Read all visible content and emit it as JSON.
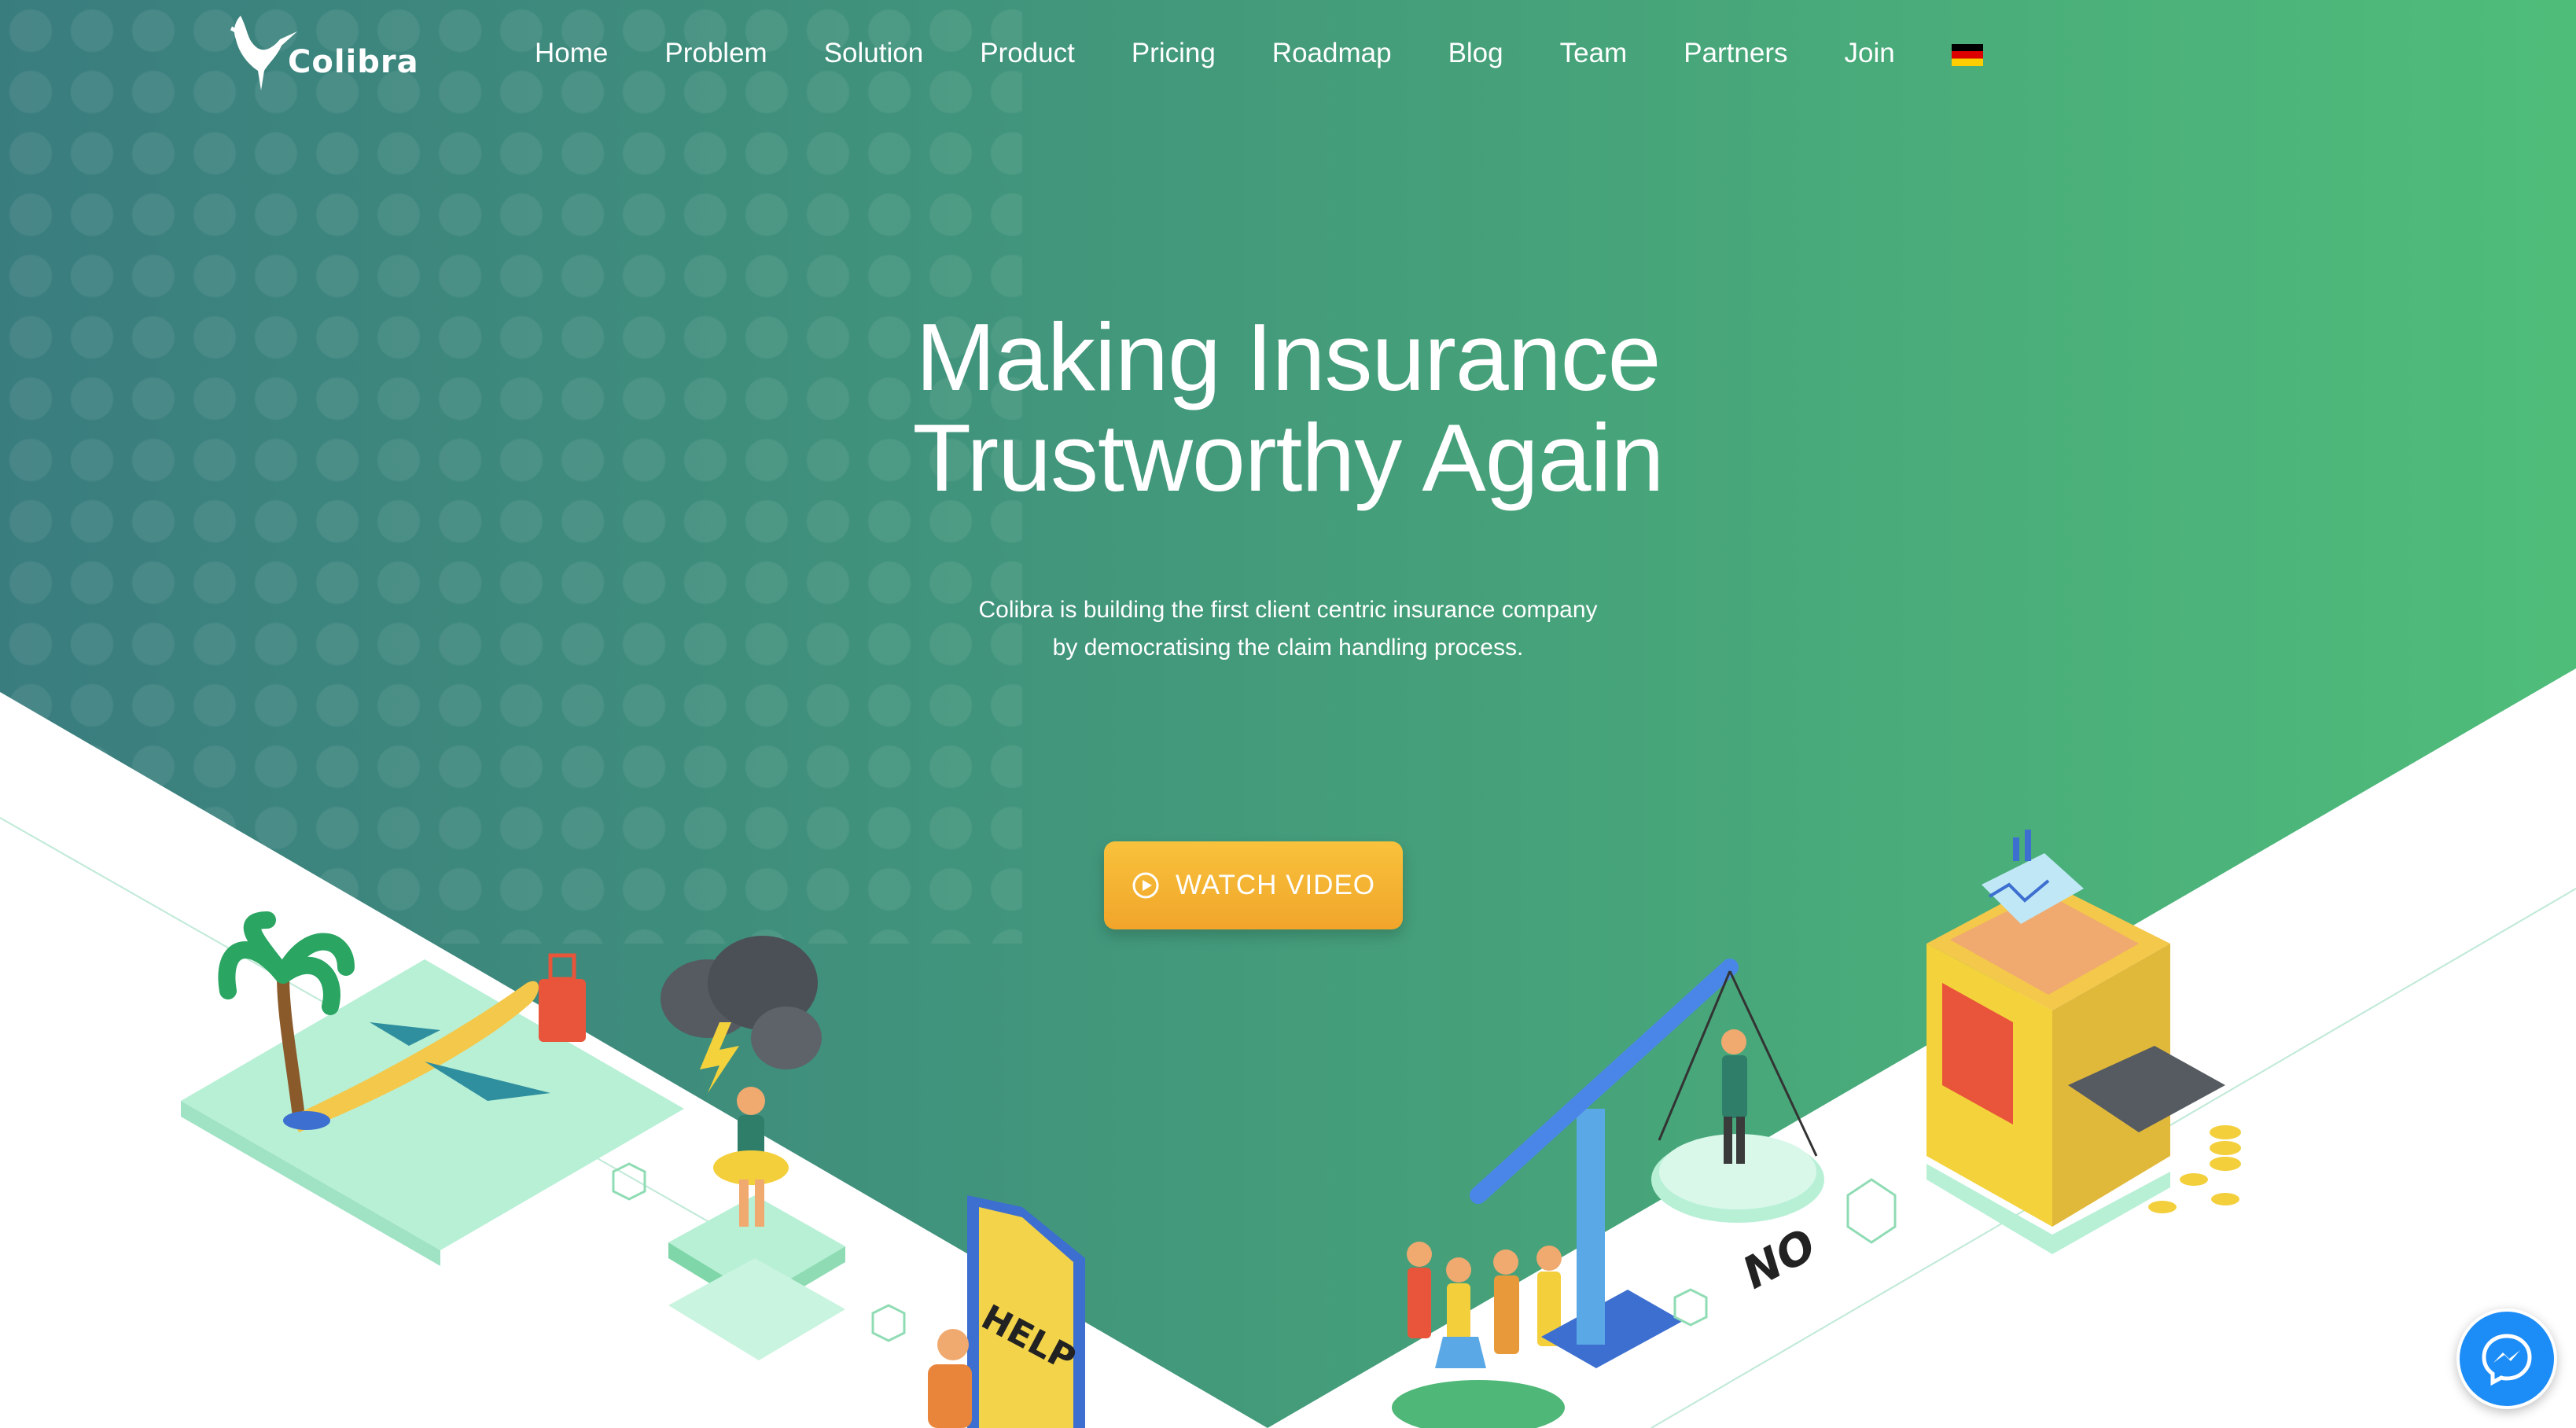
{
  "brand": {
    "name": "Colibra"
  },
  "nav": {
    "items": [
      {
        "label": "Home"
      },
      {
        "label": "Problem"
      },
      {
        "label": "Solution"
      },
      {
        "label": "Product"
      },
      {
        "label": "Pricing"
      },
      {
        "label": "Roadmap"
      },
      {
        "label": "Blog"
      },
      {
        "label": "Team"
      },
      {
        "label": "Partners"
      },
      {
        "label": "Join"
      }
    ],
    "language_icon": "german-flag-icon"
  },
  "hero": {
    "title_line1": "Making Insurance",
    "title_line2": "Trustworthy Again",
    "subtitle_line1": "Colibra is building the first client centric insurance company",
    "subtitle_line2": "by democratising the claim handling process.",
    "cta_label": "WATCH VIDEO"
  },
  "illustration": {
    "help_sign": "HELP",
    "no_label": "NO"
  },
  "colors": {
    "gradient_start": "#3a7d7f",
    "gradient_end": "#4fbd7a",
    "cta": "#f4b232",
    "messenger": "#1c8cf7"
  }
}
